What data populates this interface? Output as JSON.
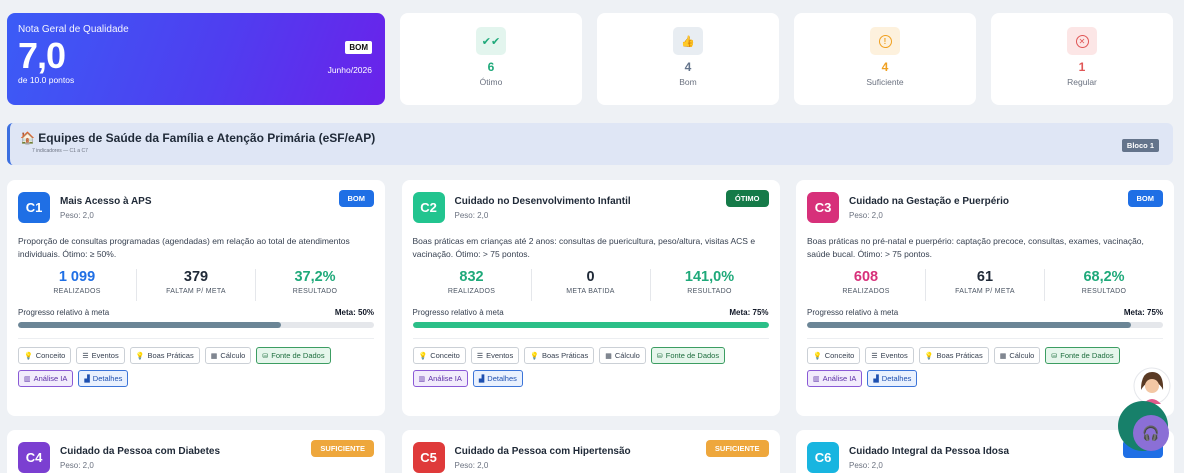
{
  "summary": {
    "label": "Nota Geral de Qualidade",
    "score": "7,0",
    "sub": "de 10.0 pontos",
    "badge": "BOM",
    "date": "Junho/2026",
    "stats": [
      {
        "icon": "double-check-icon",
        "value": "6",
        "label": "Ótimo",
        "color": "#1fa97a",
        "bg": "#e3f5ee"
      },
      {
        "icon": "thumbs-up-icon",
        "value": "4",
        "label": "Bom",
        "color": "#64748b",
        "bg": "#e8edf2"
      },
      {
        "icon": "alert-circle-icon",
        "value": "4",
        "label": "Suficiente",
        "color": "#f0a020",
        "bg": "#fdf1dd"
      },
      {
        "icon": "x-circle-icon",
        "value": "1",
        "label": "Regular",
        "color": "#e05656",
        "bg": "#fce6e6"
      }
    ]
  },
  "section": {
    "title": "Equipes de Saúde da Família e Atenção Primária (eSF/eAP)",
    "subtitle": "7 indicadores — C1 a C7",
    "block": "Bloco 1"
  },
  "buttons": {
    "concept": "Conceito",
    "events": "Eventos",
    "practices": "Boas Práticas",
    "calc": "Cálculo",
    "source": "Fonte de Dados",
    "ai": "Análise IA",
    "details": "Detalhes"
  },
  "labels": {
    "progress": "Progresso relativo à meta",
    "realized": "REALIZADOS",
    "result": "RESULTADO"
  },
  "cards": [
    {
      "code": "C1",
      "color": "#1f6fe5",
      "title": "Mais Acesso à APS",
      "peso": "Peso: 2,0",
      "status": "BOM",
      "status_color": "#1f6fe5",
      "desc": "Proporção de consultas programadas (agendadas) em relação ao total de atendimentos individuais. Ótimo: ≥ 50%.",
      "realized": "1 099",
      "gap_value": "379",
      "gap_label": "FALTAM P/ META",
      "result": "37,2%",
      "meta": "Meta: 50%",
      "progress": 0.744,
      "bar_color": "#6b8596",
      "val_color": "#1f6fe5",
      "res_color": "#1fa97a"
    },
    {
      "code": "C2",
      "color": "#22c48f",
      "title": "Cuidado no Desenvolvimento Infantil",
      "peso": "Peso: 2,0",
      "status": "ÓTIMO",
      "status_color": "#157a48",
      "desc": "Boas práticas em crianças até 2 anos: consultas de puericultura, peso/altura, visitas ACS e vacinação. Ótimo: > 75 pontos.",
      "realized": "832",
      "gap_value": "0",
      "gap_label": "META BATIDA",
      "result": "141,0%",
      "meta": "Meta: 75%",
      "progress": 1.0,
      "bar_color": "#2bbf88",
      "val_color": "#1fa97a",
      "res_color": "#1fa97a"
    },
    {
      "code": "C3",
      "color": "#d7307a",
      "title": "Cuidado na Gestação e Puerpério",
      "peso": "Peso: 2,0",
      "status": "BOM",
      "status_color": "#1f6fe5",
      "desc": "Boas práticas no pré-natal e puerpério: captação precoce, consultas, exames, vacinação, saúde bucal. Ótimo: > 75 pontos.",
      "realized": "608",
      "gap_value": "61",
      "gap_label": "FALTAM P/ META",
      "result": "68,2%",
      "meta": "Meta: 75%",
      "progress": 0.91,
      "bar_color": "#6b8596",
      "val_color": "#d7307a",
      "res_color": "#1fa97a"
    },
    {
      "code": "C4",
      "color": "#7b3fd1",
      "title": "Cuidado da Pessoa com Diabetes",
      "peso": "Peso: 2,0",
      "status": "SUFICIENTE",
      "status_color": "#eea73c"
    },
    {
      "code": "C5",
      "color": "#df3a3a",
      "title": "Cuidado da Pessoa com Hipertensão",
      "peso": "Peso: 2,0",
      "status": "SUFICIENTE",
      "status_color": "#eea73c"
    },
    {
      "code": "C6",
      "color": "#18b5e0",
      "title": "Cuidado Integral da Pessoa Idosa",
      "peso": "Peso: 2,0",
      "status": "",
      "status_color": "#1f6fe5"
    }
  ]
}
